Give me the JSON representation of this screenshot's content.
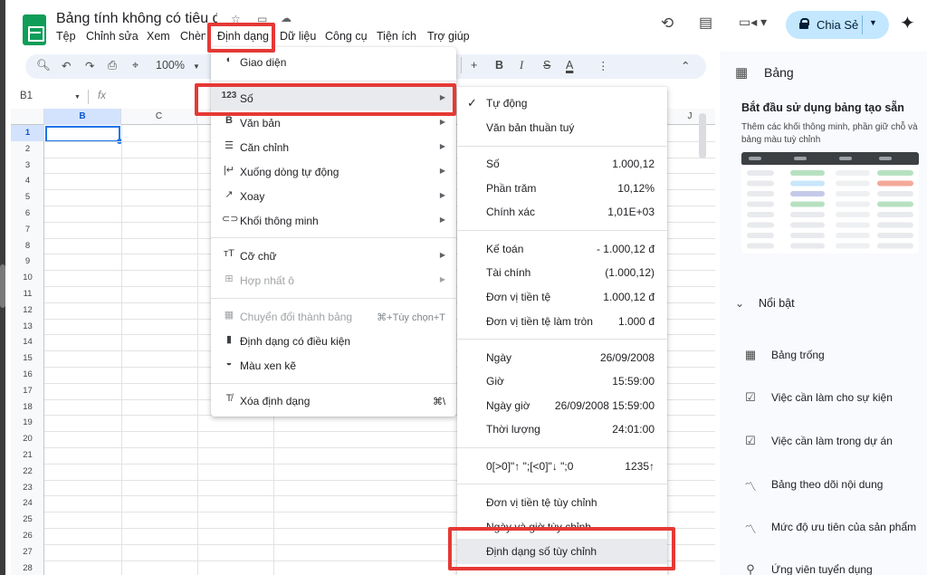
{
  "header": {
    "doc_title": "Bảng tính không có tiêu đề",
    "menu": [
      "Tệp",
      "Chỉnh sửa",
      "Xem",
      "Chèn",
      "Định dạng",
      "Dữ liệu",
      "Công cụ",
      "Tiện ích",
      "Trợ giúp"
    ],
    "share_label": "Chia Sẻ"
  },
  "toolbar": {
    "zoom": "100%",
    "bold": "B",
    "italic": "I",
    "strike": "S",
    "text_color": "A"
  },
  "formula_bar": {
    "cell_ref": "B1",
    "fx": "fx"
  },
  "grid": {
    "columns": [
      "B",
      "C",
      "J"
    ],
    "rows": [
      "1",
      "2",
      "3",
      "4",
      "5",
      "6",
      "7",
      "8",
      "9",
      "10",
      "11",
      "12",
      "13",
      "14",
      "15",
      "16",
      "17",
      "18",
      "19",
      "20",
      "21",
      "22",
      "23",
      "24",
      "25",
      "26",
      "27",
      "28"
    ]
  },
  "format_menu": {
    "items": [
      {
        "label": "Giao diện",
        "icon": "palette-icon"
      },
      {
        "label": "Số",
        "icon": "number-format-icon",
        "icon_text": "123"
      },
      {
        "label": "Văn bản",
        "icon": "bold-icon"
      },
      {
        "label": "Căn chỉnh",
        "icon": "align-icon"
      },
      {
        "label": "Xuống dòng tự động",
        "icon": "wrap-icon"
      },
      {
        "label": "Xoay",
        "icon": "rotate-icon"
      },
      {
        "label": "Khối thông minh",
        "icon": "smart-chip-icon"
      },
      {
        "label": "Cỡ chữ",
        "icon": "font-size-icon"
      },
      {
        "label": "Hợp nhất ô",
        "icon": "merge-icon"
      },
      {
        "label": "Chuyển đổi thành bảng",
        "icon": "table-icon",
        "shortcut": "⌘+Tùy chọn+T"
      },
      {
        "label": "Định dạng có điều kiện",
        "icon": "paint-roller-icon"
      },
      {
        "label": "Màu xen kẽ",
        "icon": "drop-icon"
      },
      {
        "label": "Xóa định dạng",
        "icon": "clear-format-icon",
        "shortcut": "⌘\\"
      }
    ]
  },
  "number_submenu": {
    "auto": "Tự động",
    "plain": "Văn bản thuần tuý",
    "number": {
      "label": "Số",
      "value": "1.000,12"
    },
    "percent": {
      "label": "Phần trăm",
      "value": "10,12%"
    },
    "scientific": {
      "label": "Chính xác",
      "value": "1,01E+03"
    },
    "accounting": {
      "label": "Kế toán",
      "value": "- 1.000,12 đ"
    },
    "financial": {
      "label": "Tài chính",
      "value": "(1.000,12)"
    },
    "currency": {
      "label": "Đơn vị tiền tệ",
      "value": "1.000,12 đ"
    },
    "currency_rounded": {
      "label": "Đơn vị tiền tệ làm tròn",
      "value": "1.000 đ"
    },
    "date": {
      "label": "Ngày",
      "value": "26/09/2008"
    },
    "time": {
      "label": "Giờ",
      "value": "15:59:00"
    },
    "datetime": {
      "label": "Ngày giờ",
      "value": "26/09/2008 15:59:00"
    },
    "duration": {
      "label": "Thời lượng",
      "value": "24:01:00"
    },
    "custom_pattern": {
      "label": "0[>0]\"↑ \";[<0]\"↓ \";0",
      "value": "1235↑"
    },
    "custom_currency": "Đơn vị tiền tệ tùy chỉnh",
    "custom_datetime": "Ngày và giờ tùy chỉnh",
    "custom_number": "Định dạng số tùy chỉnh"
  },
  "side_panel": {
    "title": "Bảng",
    "heading": "Bắt đầu sử dụng bảng tạo sẵn",
    "description": "Thêm các khối thông minh, phần giữ chỗ và bảng màu tuỳ chỉnh",
    "section": "Nổi bật",
    "items": [
      {
        "label": "Bảng trống",
        "icon": "table-icon"
      },
      {
        "label": "Việc cần làm cho sự kiện",
        "icon": "checklist-icon"
      },
      {
        "label": "Việc cần làm trong dự án",
        "icon": "checklist-icon"
      },
      {
        "label": "Bảng theo dõi nội dung",
        "icon": "trend-icon"
      },
      {
        "label": "Mức độ ưu tiên của sản phẩm",
        "icon": "trend-icon"
      },
      {
        "label": "Ứng viên tuyển dụng",
        "icon": "person-icon"
      }
    ]
  },
  "colors": {
    "accent": "#1a73e8",
    "highlight_box": "#e53935",
    "share_bg": "#c2e7ff",
    "sheets_green": "#0f9d58"
  }
}
